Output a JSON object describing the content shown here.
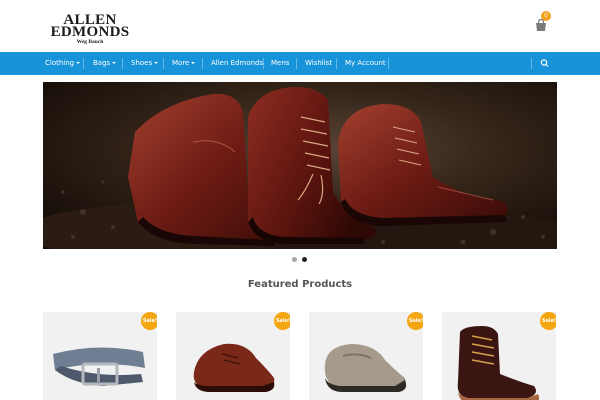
{
  "logo": {
    "line1": "ALLEN",
    "line2": "EDMONDS",
    "line3": "Weg Bauch"
  },
  "cart": {
    "count": "0"
  },
  "nav": {
    "items": [
      {
        "label": "Clothing",
        "dropdown": true
      },
      {
        "label": "Bags",
        "dropdown": true
      },
      {
        "label": "Shoes",
        "dropdown": true
      },
      {
        "label": "More",
        "dropdown": true
      },
      {
        "label": "Allen Edmonds",
        "dropdown": false
      },
      {
        "label": "Mens",
        "dropdown": false
      },
      {
        "label": "Wishlist",
        "dropdown": false
      },
      {
        "label": "My Account",
        "dropdown": false
      }
    ]
  },
  "slider": {
    "active_dot": 2,
    "dot_count": 2
  },
  "featured": {
    "title": "Featured Products",
    "products": [
      {
        "badge": "Sale!",
        "icon": "belt-image"
      },
      {
        "badge": "Sale!",
        "icon": "oxford-shoe-image"
      },
      {
        "badge": "Sale!",
        "icon": "loafer-image"
      },
      {
        "badge": "Sale!",
        "icon": "boot-image"
      }
    ]
  },
  "colors": {
    "accent": "#1793d9",
    "sale_badge": "#f3a512",
    "cart_badge": "#f0a21a"
  }
}
